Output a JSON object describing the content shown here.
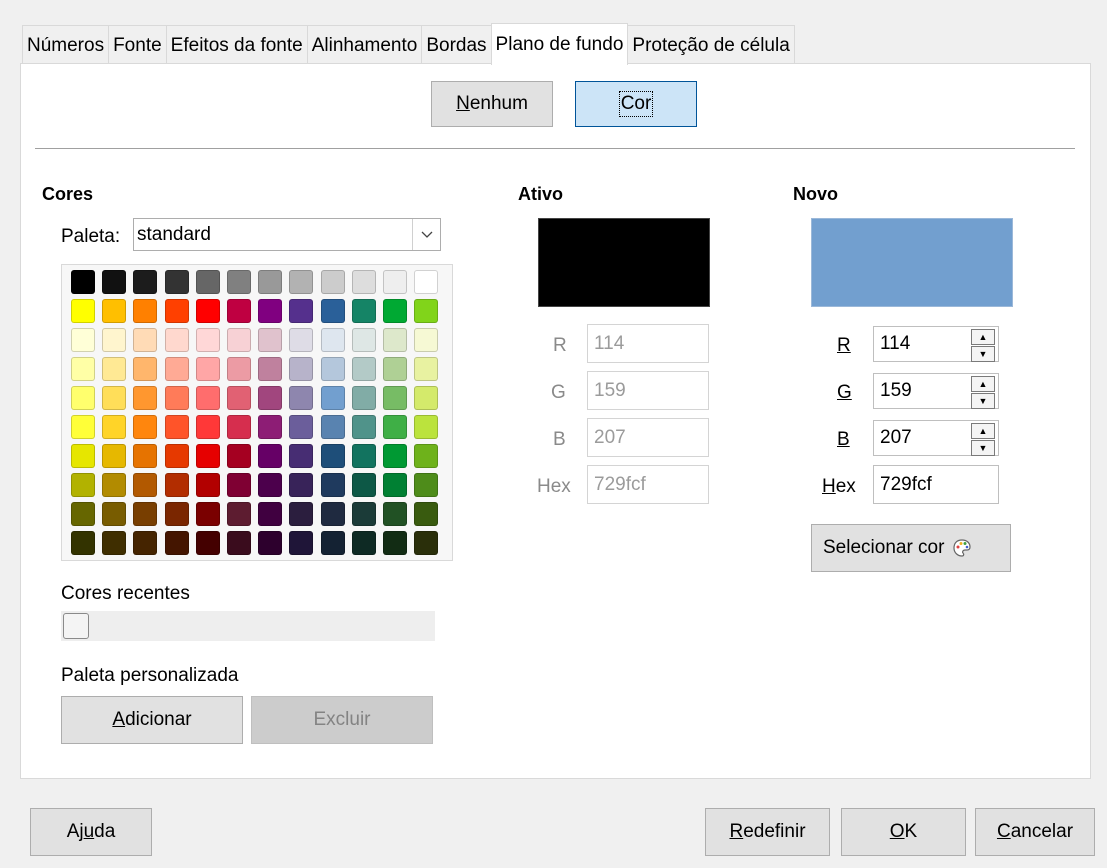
{
  "tabs": [
    "Números",
    "Fonte",
    "Efeitos da fonte",
    "Alinhamento",
    "Bordas",
    "Plano de fundo",
    "Proteção de célula"
  ],
  "active_tab": "Plano de fundo",
  "mode_buttons": {
    "none_prefix": "",
    "none_mnemonic": "N",
    "none_rest": "enhum",
    "color": "Cor"
  },
  "colors": {
    "heading": "Cores",
    "palette_label": "Paleta:",
    "palette_value": "standard",
    "recent_label": "Cores recentes",
    "custom_label": "Paleta personalizada",
    "add_mnemonic": "A",
    "add_rest": "dicionar",
    "delete_label": "Excluir"
  },
  "active": {
    "heading": "Ativo",
    "color": "#000000",
    "r_label": "R",
    "g_label": "G",
    "b_label": "B",
    "hex_label": "Hex",
    "r": "114",
    "g": "159",
    "b": "207",
    "hex": "729fcf"
  },
  "new": {
    "heading": "Novo",
    "color": "#729fcf",
    "r_label": "R",
    "g_label": "G",
    "b_label": "B",
    "hex_mnemonic": "H",
    "hex_rest": "ex",
    "r": "114",
    "g": "159",
    "b": "207",
    "hex": "729fcf",
    "pick_label": "Selecionar cor"
  },
  "footer": {
    "help_pre": "Aj",
    "help_mnemonic": "u",
    "help_post": "da",
    "reset_mnemonic": "R",
    "reset_rest": "edefinir",
    "ok_mnemonic": "O",
    "ok_rest": "K",
    "cancel_mnemonic": "C",
    "cancel_rest": "ancelar"
  },
  "palette_colors": [
    [
      "#000000",
      "#111111",
      "#1c1c1c",
      "#333333",
      "#666666",
      "#808080",
      "#999999",
      "#b2b2b2",
      "#cccccc",
      "#dddddd",
      "#eeeeee",
      "#ffffff"
    ],
    [
      "#ffff00",
      "#ffbf00",
      "#ff8000",
      "#ff4000",
      "#ff0000",
      "#bf0041",
      "#800080",
      "#55308d",
      "#2a6099",
      "#158466",
      "#00a933",
      "#81d41a"
    ],
    [
      "#ffffd7",
      "#fff5ce",
      "#ffdbb6",
      "#ffd8ce",
      "#ffd7d7",
      "#f7d1d5",
      "#e0c2cd",
      "#dedce6",
      "#dee6ef",
      "#dee7e5",
      "#dde8cb",
      "#f6f9d4"
    ],
    [
      "#ffffa6",
      "#ffe994",
      "#ffb66c",
      "#ffaa95",
      "#ffa6a6",
      "#ec9ba4",
      "#bf819e",
      "#b7b3ca",
      "#b4c7dc",
      "#b3cac7",
      "#afd095",
      "#e8f2a1"
    ],
    [
      "#ffff6d",
      "#ffde59",
      "#ff972f",
      "#ff7b59",
      "#ff6d6d",
      "#e16173",
      "#a1467e",
      "#8e86ae",
      "#729fcf",
      "#81aca6",
      "#77bc65",
      "#d4ea6b"
    ],
    [
      "#ffff38",
      "#ffd428",
      "#ff860d",
      "#ff5429",
      "#ff3838",
      "#d62e4e",
      "#8d1d75",
      "#6b5e9b",
      "#5983b0",
      "#50938a",
      "#3faf46",
      "#bbe33d"
    ],
    [
      "#e6e600",
      "#e6b800",
      "#e67300",
      "#e63900",
      "#e60000",
      "#a50021",
      "#660066",
      "#472d73",
      "#1e4e79",
      "#12735f",
      "#009933",
      "#6eb21b"
    ],
    [
      "#b2b200",
      "#b28b00",
      "#b25900",
      "#b22d00",
      "#b20000",
      "#7f0033",
      "#4c004c",
      "#382359",
      "#1f3a5e",
      "#0d5846",
      "#008033",
      "#4e8c1a"
    ],
    [
      "#666600",
      "#785c00",
      "#783e00",
      "#7a2600",
      "#7a0000",
      "#5d1c30",
      "#400040",
      "#2b1e3e",
      "#1f2a40",
      "#1b3b38",
      "#215124",
      "#395b0f"
    ],
    [
      "#333300",
      "#3f2e00",
      "#452400",
      "#441500",
      "#440000",
      "#3a0c1d",
      "#2d002d",
      "#1f1538",
      "#142233",
      "#0e2a24",
      "#122c14",
      "#2a2f0a"
    ]
  ]
}
